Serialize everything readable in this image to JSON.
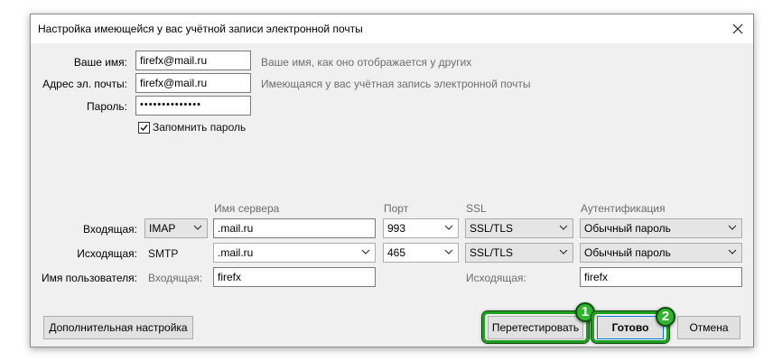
{
  "dialog": {
    "title": "Настройка имеющейся у вас учётной записи электронной почты"
  },
  "account": {
    "name_label": "Ваше имя:",
    "name_value": "firefx@mail.ru",
    "name_hint": "Ваше имя, как оно отображается у других",
    "email_label": "Адрес эл. почты:",
    "email_value": "firefx@mail.ru",
    "email_hint": "Имеющаяся у вас учётная запись электронной почты",
    "password_label": "Пароль:",
    "password_value": "••••••••••••••",
    "remember_label": "Запомнить пароль",
    "remember_checked": true
  },
  "server": {
    "headers": {
      "server_name": "Имя сервера",
      "port": "Порт",
      "ssl": "SSL",
      "auth": "Аутентификация"
    },
    "incoming": {
      "label": "Входящая:",
      "protocol": "IMAP",
      "hostname": ".mail.ru",
      "port": "993",
      "ssl": "SSL/TLS",
      "auth": "Обычный пароль"
    },
    "outgoing": {
      "label": "Исходящая:",
      "protocol": "SMTP",
      "hostname": ".mail.ru",
      "port": "465",
      "ssl": "SSL/TLS",
      "auth": "Обычный пароль"
    },
    "username": {
      "label": "Имя пользователя:",
      "incoming_label": "Входящая:",
      "incoming_value": "firefx",
      "outgoing_label": "Исходящая:",
      "outgoing_value": "firefx"
    }
  },
  "buttons": {
    "advanced": "Дополнительная настройка",
    "retest": "Перетестировать",
    "done": "Готово",
    "cancel": "Отмена"
  },
  "annotations": {
    "badge1": "1",
    "badge2": "2",
    "highlight_color": "#1ea01e"
  }
}
